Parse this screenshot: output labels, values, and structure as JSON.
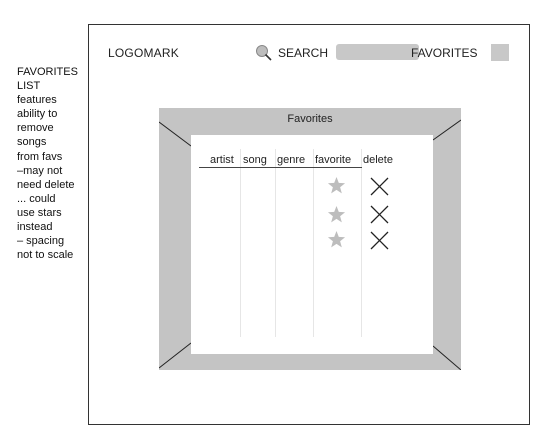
{
  "annotation": {
    "lines": [
      "FAVORITES",
      "LIST",
      "features",
      "ability to",
      "remove",
      "songs",
      "from favs",
      "–may not",
      "need delete",
      "... could",
      "use stars",
      "instead",
      "– spacing",
      "not to scale"
    ]
  },
  "header": {
    "logo": "LOGOMARK",
    "search_label": "SEARCH",
    "search_value": "",
    "favorites_label": "FAVORITES"
  },
  "modal": {
    "title": "Favorites",
    "columns": [
      "artist",
      "song",
      "genre",
      "favorite",
      "delete"
    ],
    "rows": [
      {
        "favorite": "star-icon",
        "delete": "x-icon"
      },
      {
        "favorite": "star-icon",
        "delete": "x-icon"
      },
      {
        "favorite": "star-icon",
        "delete": "x-icon"
      }
    ]
  },
  "colors": {
    "placeholder_gray": "#c8c8c8",
    "star_gray": "#bdbdbd",
    "line": "#333333"
  }
}
